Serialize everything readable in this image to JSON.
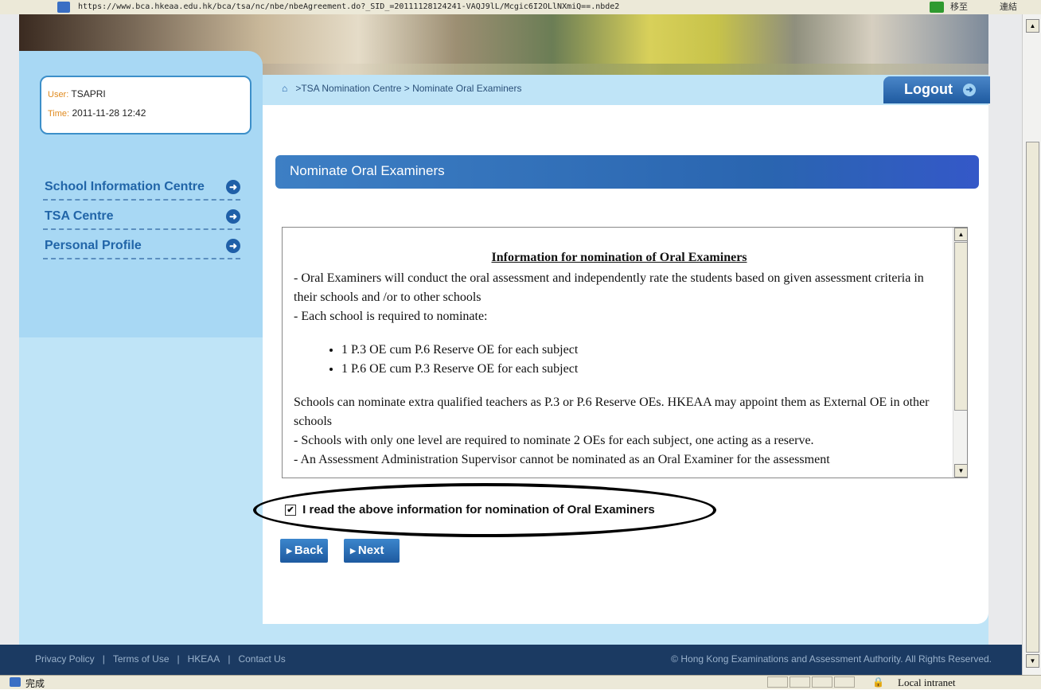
{
  "browser": {
    "url": "https://www.bca.hkeaa.edu.hk/bca/tsa/nc/nbe/nbeAgreement.do?_SID_=20111128124241-VAQJ9lL/Mcgic6I2OLlNXmiQ==.nbde2",
    "right_label": "移至",
    "right_label2": "連結",
    "status_text": "完成",
    "zone_text": "Local intranet"
  },
  "user": {
    "user_key": "User:",
    "user_value": "TSAPRI",
    "time_key": "Time:",
    "time_value": "2011-11-28 12:42"
  },
  "nav": {
    "items": [
      {
        "label": "School Information Centre"
      },
      {
        "label": "TSA Centre"
      },
      {
        "label": "Personal Profile"
      }
    ]
  },
  "breadcrumb": ">TSA Nomination Centre > Nominate Oral Examiners",
  "logout_label": "Logout",
  "page_title": "Nominate Oral Examiners",
  "info": {
    "title": "Information for nomination of Oral Examiners",
    "p1": "-  Oral Examiners will conduct the oral assessment and independently rate the students based on given assessment criteria in their schools and /or to other schools",
    "p2": "-  Each school is required to nominate:",
    "bullets": [
      "1 P.3 OE cum P.6 Reserve OE for each subject",
      "1 P.6 OE cum P.3 Reserve OE for each subject"
    ],
    "p3": "Schools can nominate extra qualified teachers as P.3 or P.6 Reserve OEs. HKEAA may appoint them as External OE in other schools",
    "p4": "-  Schools with only one level are required to nominate 2 OEs for each subject, one acting as a reserve.",
    "p5": "-  An Assessment Administration Supervisor cannot be nominated as an Oral Examiner for the assessment"
  },
  "ack": {
    "checked": true,
    "label": "I read the above information for nomination of Oral Examiners"
  },
  "buttons": {
    "back": "Back",
    "next": "Next"
  },
  "footer": {
    "links": [
      "Privacy Policy",
      "Terms of Use",
      "HKEAA",
      "Contact Us"
    ],
    "copyright": "© Hong Kong Examinations and Assessment Authority. All Rights Reserved."
  }
}
